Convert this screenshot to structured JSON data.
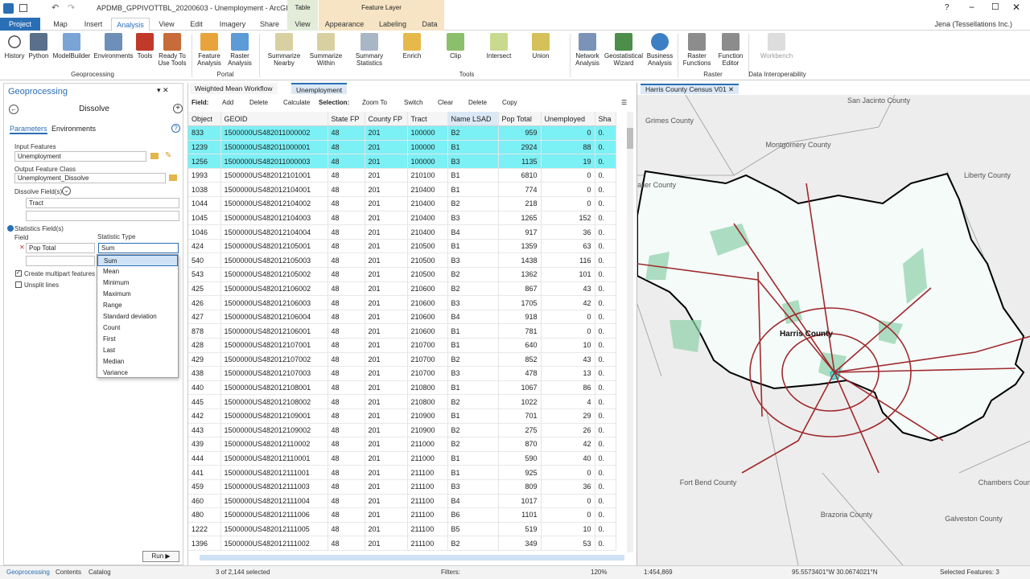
{
  "window": {
    "title": "APDMB_GPPIVOTTBL_20200603 - Unemployment - ArcGIS Pro",
    "context_tab": "Table",
    "context_group": "Feature Layer",
    "user": "Jena (Tessellations Inc.)",
    "help": "?"
  },
  "tabs": [
    "Project",
    "Map",
    "Insert",
    "Analysis",
    "View",
    "Edit",
    "Imagery",
    "Share",
    "View",
    "Appearance",
    "Labeling",
    "Data"
  ],
  "ribbon": {
    "geoprocessing": [
      "History",
      "Python",
      "ModelBuilder",
      "Environments",
      "Tools",
      "Ready To\nUse Tools"
    ],
    "portal": [
      "Feature\nAnalysis",
      "Raster\nAnalysis"
    ],
    "tools": [
      "Summarize\nNearby",
      "Summarize\nWithin",
      "Summary\nStatistics",
      "Enrich",
      "Clip",
      "Intersect",
      "Union"
    ],
    "more": [
      "Network\nAnalysis",
      "Geostatistical\nWizard",
      "Business\nAnalysis"
    ],
    "raster": [
      "Raster\nFunctions",
      "Function\nEditor"
    ],
    "interop": [
      "Workbench"
    ],
    "groups": {
      "geoprocessing": "Geoprocessing",
      "portal": "Portal",
      "tools": "Tools",
      "raster": "Raster",
      "interop": "Data Interoperability"
    }
  },
  "gp": {
    "pane_title": "Geoprocessing",
    "tool": "Dissolve",
    "tab_params": "Parameters",
    "tab_env": "Environments",
    "input_label": "Input Features",
    "input_value": "Unemployment",
    "output_label": "Output Feature Class",
    "output_value": "Unemployment_Dissolve",
    "dissolve_label": "Dissolve Field(s)",
    "dissolve_value": "Tract",
    "stats_label": "Statistics Field(s)",
    "field_label": "Field",
    "stat_type_label": "Statistic Type",
    "field_value": "Pop Total",
    "stat_value": "Sum",
    "options": [
      "Sum",
      "Mean",
      "Minimum",
      "Maximum",
      "Range",
      "Standard deviation",
      "Count",
      "First",
      "Last",
      "Median",
      "Variance"
    ],
    "multipart": "Create multipart features",
    "unsplit": "Unsplit lines",
    "run": "Run"
  },
  "table": {
    "tab1": "Weighted Mean Workflow",
    "tab2": "Unemployment",
    "toolbar": {
      "field": "Field:",
      "add": "Add",
      "delete": "Delete",
      "calculate": "Calculate",
      "selection": "Selection:",
      "zoom": "Zoom To",
      "switch": "Switch",
      "clear": "Clear",
      "delete2": "Delete",
      "copy": "Copy"
    },
    "columns": [
      "Object",
      "GEOID",
      "State FP",
      "County FP",
      "Tract",
      "Name LSAD",
      "Pop Total",
      "Unemployed",
      "Sha"
    ],
    "rows": [
      [
        "833",
        "1500000US482011000002",
        "48",
        "201",
        "100000",
        "B2",
        "959",
        "0",
        "0."
      ],
      [
        "1239",
        "1500000US482011000001",
        "48",
        "201",
        "100000",
        "B1",
        "2924",
        "88",
        "0."
      ],
      [
        "1256",
        "1500000US482011000003",
        "48",
        "201",
        "100000",
        "B3",
        "1135",
        "19",
        "0."
      ],
      [
        "1993",
        "1500000US482012101001",
        "48",
        "201",
        "210100",
        "B1",
        "6810",
        "0",
        "0."
      ],
      [
        "1038",
        "1500000US482012104001",
        "48",
        "201",
        "210400",
        "B1",
        "774",
        "0",
        "0."
      ],
      [
        "1044",
        "1500000US482012104002",
        "48",
        "201",
        "210400",
        "B2",
        "218",
        "0",
        "0."
      ],
      [
        "1045",
        "1500000US482012104003",
        "48",
        "201",
        "210400",
        "B3",
        "1265",
        "152",
        "0."
      ],
      [
        "1046",
        "1500000US482012104004",
        "48",
        "201",
        "210400",
        "B4",
        "917",
        "36",
        "0."
      ],
      [
        "424",
        "1500000US482012105001",
        "48",
        "201",
        "210500",
        "B1",
        "1359",
        "63",
        "0."
      ],
      [
        "540",
        "1500000US482012105003",
        "48",
        "201",
        "210500",
        "B3",
        "1438",
        "116",
        "0."
      ],
      [
        "543",
        "1500000US482012105002",
        "48",
        "201",
        "210500",
        "B2",
        "1362",
        "101",
        "0."
      ],
      [
        "425",
        "1500000US482012106002",
        "48",
        "201",
        "210600",
        "B2",
        "867",
        "43",
        "0."
      ],
      [
        "426",
        "1500000US482012106003",
        "48",
        "201",
        "210600",
        "B3",
        "1705",
        "42",
        "0."
      ],
      [
        "427",
        "1500000US482012106004",
        "48",
        "201",
        "210600",
        "B4",
        "918",
        "0",
        "0."
      ],
      [
        "878",
        "1500000US482012106001",
        "48",
        "201",
        "210600",
        "B1",
        "781",
        "0",
        "0."
      ],
      [
        "428",
        "1500000US482012107001",
        "48",
        "201",
        "210700",
        "B1",
        "640",
        "10",
        "0."
      ],
      [
        "429",
        "1500000US482012107002",
        "48",
        "201",
        "210700",
        "B2",
        "852",
        "43",
        "0."
      ],
      [
        "438",
        "1500000US482012107003",
        "48",
        "201",
        "210700",
        "B3",
        "478",
        "13",
        "0."
      ],
      [
        "440",
        "1500000US482012108001",
        "48",
        "201",
        "210800",
        "B1",
        "1067",
        "86",
        "0."
      ],
      [
        "445",
        "1500000US482012108002",
        "48",
        "201",
        "210800",
        "B2",
        "1022",
        "4",
        "0."
      ],
      [
        "442",
        "1500000US482012109001",
        "48",
        "201",
        "210900",
        "B1",
        "701",
        "29",
        "0."
      ],
      [
        "443",
        "1500000US482012109002",
        "48",
        "201",
        "210900",
        "B2",
        "275",
        "26",
        "0."
      ],
      [
        "439",
        "1500000US482012110002",
        "48",
        "201",
        "211000",
        "B2",
        "870",
        "42",
        "0."
      ],
      [
        "444",
        "1500000US482012110001",
        "48",
        "201",
        "211000",
        "B1",
        "590",
        "40",
        "0."
      ],
      [
        "441",
        "1500000US482012111001",
        "48",
        "201",
        "211100",
        "B1",
        "925",
        "0",
        "0."
      ],
      [
        "459",
        "1500000US482012111003",
        "48",
        "201",
        "211100",
        "B3",
        "809",
        "36",
        "0."
      ],
      [
        "460",
        "1500000US482012111004",
        "48",
        "201",
        "211100",
        "B4",
        "1017",
        "0",
        "0."
      ],
      [
        "480",
        "1500000US482012111006",
        "48",
        "201",
        "211100",
        "B6",
        "1101",
        "0",
        "0."
      ],
      [
        "1222",
        "1500000US482012111005",
        "48",
        "201",
        "211100",
        "B5",
        "519",
        "10",
        "0."
      ],
      [
        "1396",
        "1500000US482012111002",
        "48",
        "201",
        "211100",
        "B2",
        "349",
        "53",
        "0."
      ]
    ],
    "selected_count": "3 of 2,144 selected",
    "filters": "Filters:",
    "zoom": "120%"
  },
  "map": {
    "tab": "Harris County Census V01",
    "labels": [
      "San Jacinto\nCounty",
      "Grimes County",
      "Montgomery\nCounty",
      "Waller\nCounty",
      "Liberty\nCounty",
      "Harris County",
      "Fort Bend\nCounty",
      "Brazoria\nCounty",
      "Galveston\nCounty",
      "Chambers\nCounty"
    ],
    "scale": "1:454,869",
    "coords": "95.5573401°W 30.0674021°N",
    "selected": "Selected Features: 3"
  },
  "bottom_tabs": [
    "Geoprocessing",
    "Contents",
    "Catalog"
  ]
}
